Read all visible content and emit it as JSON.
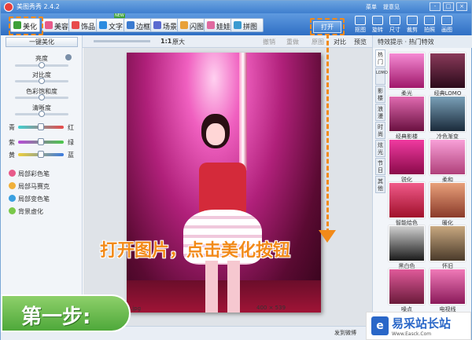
{
  "window": {
    "title": "美图秀秀 2.4.2",
    "links": [
      "菜单",
      "提意见"
    ],
    "buttons": [
      "-",
      "□",
      "×"
    ]
  },
  "tabs": [
    {
      "label": "美化",
      "color": "#3da03a"
    },
    {
      "label": "美容",
      "color": "#e85a8a"
    },
    {
      "label": "饰品",
      "color": "#e84a4a"
    },
    {
      "label": "文字",
      "color": "#2b8be0",
      "badge": "NEW"
    },
    {
      "label": "边框",
      "color": "#3a7ad0"
    },
    {
      "label": "场景",
      "color": "#5a6ad0"
    },
    {
      "label": "闪图",
      "color": "#e8a13a"
    },
    {
      "label": "娃娃",
      "color": "#e06aa0"
    },
    {
      "label": "拼图",
      "color": "#3a9ad0"
    }
  ],
  "right_tools": [
    "抠图",
    "旋转",
    "尺寸",
    "裁剪",
    "拍照",
    "画图"
  ],
  "open_button": "打开",
  "subbar": {
    "zoom_ratio": "1:1",
    "original": "原大",
    "undo": "撤销",
    "redo": "重做",
    "reset": "原图",
    "compare": "对比",
    "preview": "预览"
  },
  "left_panel": {
    "one_key": "一键美化",
    "sliders": [
      {
        "label": "亮度",
        "value": 0.5
      },
      {
        "label": "对比度",
        "value": 0.5
      },
      {
        "label": "色彩饱和度",
        "value": 0.5
      },
      {
        "label": "清晰度",
        "value": 0.5
      }
    ],
    "color_sliders": [
      {
        "left": "青",
        "right": "红",
        "value": 0.5,
        "gradient": "linear-gradient(90deg,#3fd1d1,#e84a4a)"
      },
      {
        "left": "紫",
        "right": "绿",
        "value": 0.5,
        "gradient": "linear-gradient(90deg,#b84ad8,#4ac84a)"
      },
      {
        "left": "黄",
        "right": "蓝",
        "value": 0.5,
        "gradient": "linear-gradient(90deg,#f0d03a,#3a7ae0)"
      }
    ],
    "tools": [
      "局部彩色笔",
      "局部马赛克",
      "局部变色笔",
      "背景虚化"
    ]
  },
  "right_panel": {
    "header": "特效提示",
    "hot": "热门特效",
    "vtabs": [
      "热门",
      "LOMO",
      "影楼",
      "浪漫",
      "时尚",
      "炫光",
      "节日",
      "其他"
    ],
    "thumbs": [
      {
        "label": "柔光",
        "bg": "linear-gradient(#f58ad4,#a0186a)"
      },
      {
        "label": "经典LOMO",
        "bg": "linear-gradient(#8a3a5a,#2a0a1a)"
      },
      {
        "label": "经典影楼",
        "bg": "linear-gradient(#e06ab0,#6a1040)"
      },
      {
        "label": "冷色渐变",
        "bg": "linear-gradient(#7aa0b8,#1a2a3a)"
      },
      {
        "label": "锐化",
        "bg": "linear-gradient(#f03aa0,#8a0a4a)"
      },
      {
        "label": "柔和",
        "bg": "linear-gradient(#f8a0d8,#b0407a)"
      },
      {
        "label": "智能绘色",
        "bg": "linear-gradient(#f05a8a,#a0102a)"
      },
      {
        "label": "暖化",
        "bg": "linear-gradient(#e8a07a,#8a3a2a)"
      },
      {
        "label": "黑白色",
        "bg": "linear-gradient(#d0d0d0,#1a1a1a)"
      },
      {
        "label": "怀旧",
        "bg": "linear-gradient(#c8a880,#4a3a2a)"
      },
      {
        "label": "噪点",
        "bg": "linear-gradient(#e05a9a,#6a1a3a)"
      },
      {
        "label": "电视线",
        "bg": "linear-gradient(#f07ab8,#8a1a5a)"
      }
    ]
  },
  "status": {
    "filename": "美.jpg",
    "dimensions": "400 × 539",
    "weibo": "发到微博"
  },
  "instruction": "打开图片，点击美化按钮",
  "step_label": "第一步:",
  "watermark": {
    "name": "易采站长站",
    "url": "Www.Easck.Com",
    "icon": "e"
  }
}
